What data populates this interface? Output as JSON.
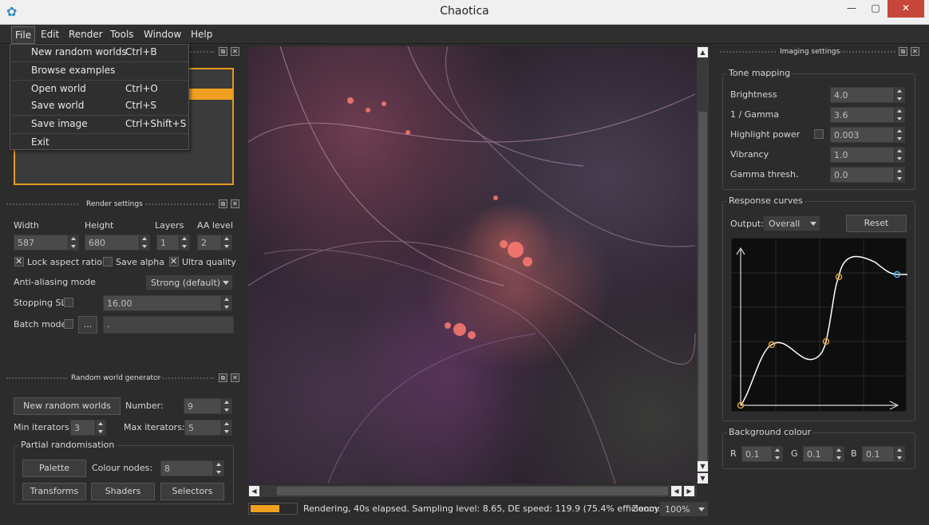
{
  "window": {
    "title": "Chaotica",
    "minimize": "—",
    "maximize": "▢",
    "close": "✕"
  },
  "menubar": [
    "File",
    "Edit",
    "Render",
    "Tools",
    "Window",
    "Help"
  ],
  "file_menu": [
    {
      "label": "New random worlds",
      "shortcut": "Ctrl+B"
    },
    {
      "label": "Browse examples",
      "shortcut": ""
    },
    {
      "label": "Open world",
      "shortcut": "Ctrl+O"
    },
    {
      "label": "Save world",
      "shortcut": "Ctrl+S"
    },
    {
      "label": "Save image",
      "shortcut": "Ctrl+Shift+S"
    },
    {
      "label": "Exit",
      "shortcut": ""
    }
  ],
  "render_settings": {
    "title": "Render settings",
    "width_label": "Width",
    "width": "587",
    "height_label": "Height",
    "height": "680",
    "layers_label": "Layers",
    "layers": "1",
    "aa_label": "AA level",
    "aa": "2",
    "lock_aspect": "Lock aspect ratio",
    "lock_aspect_checked": true,
    "save_alpha": "Save alpha",
    "save_alpha_checked": false,
    "ultra_quality": "Ultra quality",
    "ultra_quality_checked": true,
    "aa_mode_label": "Anti-aliasing mode",
    "aa_mode": "Strong (default)",
    "stopping_sl_label": "Stopping SL",
    "stopping_sl": "16.00",
    "batch_label": "Batch mode",
    "batch_btn": "...",
    "batch_value": "."
  },
  "random_world": {
    "title": "Random world generator",
    "new_btn": "New random worlds",
    "number_label": "Number:",
    "number": "9",
    "min_label": "Min iterators:",
    "min": "3",
    "max_label": "Max iterators:",
    "max": "5",
    "partial_label": "Partial randomisation",
    "palette_btn": "Palette",
    "colour_nodes_label": "Colour nodes:",
    "colour_nodes": "8",
    "transforms_btn": "Transforms",
    "shaders_btn": "Shaders",
    "selectors_btn": "Selectors"
  },
  "status": {
    "text": "Rendering, 40s elapsed. Sampling level: 8.65, DE speed: 119.9 (75.4% efficiency). I",
    "zoom_label": "Zoom:",
    "zoom": "100%",
    "progress": 0.6
  },
  "imaging": {
    "title": "Imaging settings",
    "tone_label": "Tone mapping",
    "brightness_label": "Brightness",
    "brightness": "4.0",
    "gamma_label": "1 / Gamma",
    "gamma": "3.6",
    "highlight_label": "Highlight power",
    "highlight": "0.003",
    "vibrancy_label": "Vibrancy",
    "vibrancy": "1.0",
    "gamma_thresh_label": "Gamma thresh.",
    "gamma_thresh": "0.0",
    "response_label": "Response curves",
    "output_label": "Output:",
    "output": "Overall",
    "reset_btn": "Reset",
    "bg_label": "Background colour",
    "r_label": "R",
    "r": "0.1",
    "g_label": "G",
    "g": "0.1",
    "b_label": "B",
    "b": "0.1"
  },
  "colors": {
    "accent": "#f0a020",
    "panel": "#333333",
    "curve_point": "#e0a030",
    "curve_end": "#4ab0e0"
  }
}
